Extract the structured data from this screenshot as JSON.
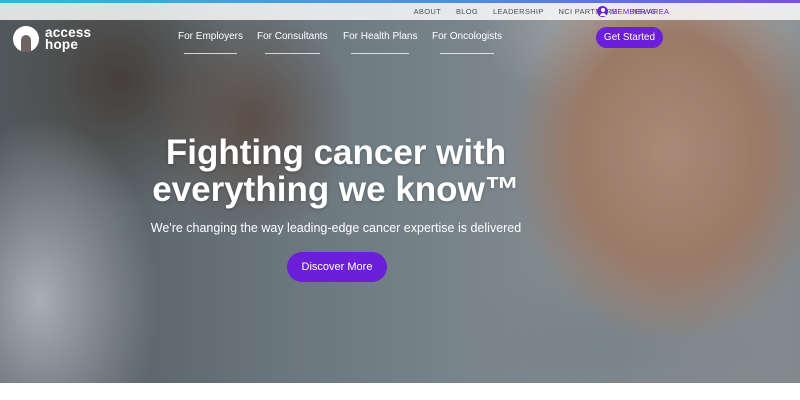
{
  "utility_nav": {
    "items": [
      "ABOUT",
      "BLOG",
      "LEADERSHIP",
      "NCI PARTNERS",
      "NEWS"
    ],
    "member_area": "MEMBER AREA"
  },
  "logo": {
    "line1": "access",
    "line2": "hope"
  },
  "main_nav": {
    "items": [
      "For Employers",
      "For Consultants",
      "For Health Plans",
      "For Oncologists"
    ],
    "cta": "Get Started"
  },
  "hero": {
    "headline_line1": "Fighting cancer with",
    "headline_line2": "everything we know™",
    "subheadline": "We're changing the way leading-edge cancer expertise is delivered",
    "cta": "Discover More"
  },
  "colors": {
    "brand_purple": "#6b1fd8",
    "accent_gradient": [
      "#2fb6e6",
      "#7a4fe0"
    ],
    "white": "#ffffff"
  }
}
